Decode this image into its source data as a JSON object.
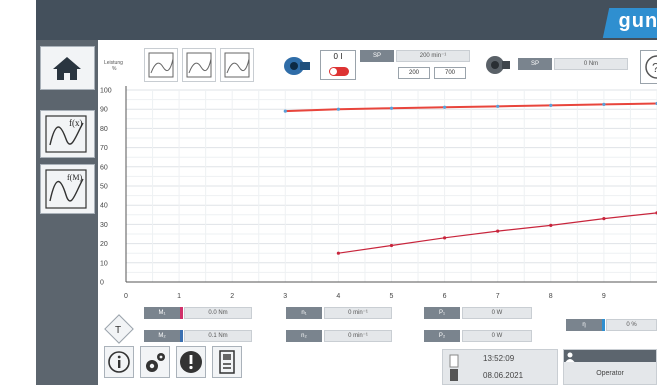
{
  "logo": {
    "text": "gun"
  },
  "header": {
    "axis_unit_line1": "Leistung",
    "axis_unit_line2": "%",
    "speed_sp_label": "SP",
    "speed_sp_value": "200 min⁻¹",
    "speed_min": "200",
    "speed_max": "700",
    "toggle_label": "0 I",
    "torque_sp_label": "SP",
    "torque_sp_value": "0 Nm"
  },
  "chart_data": {
    "type": "line",
    "x_ticks": [
      "0",
      "1",
      "2",
      "3",
      "4",
      "5",
      "6",
      "7",
      "8",
      "9"
    ],
    "y_ticks": [
      "100",
      "90",
      "80",
      "70",
      "60",
      "50",
      "40",
      "30",
      "20",
      "10",
      "0"
    ],
    "xlim": [
      0,
      10
    ],
    "ylim": [
      0,
      100
    ],
    "grid": true,
    "series": [
      {
        "color": "#e8453c",
        "x": [
          3,
          4,
          5,
          6,
          7,
          8,
          9,
          10
        ],
        "y": [
          89,
          90,
          90.5,
          91,
          91.5,
          92,
          92.5,
          93
        ]
      },
      {
        "color": "#c8253c",
        "x": [
          4,
          5,
          6,
          7,
          8,
          9,
          10
        ],
        "y": [
          15,
          19,
          23,
          26.5,
          29.5,
          33,
          36
        ]
      }
    ]
  },
  "readouts": {
    "m1_label": "M₁",
    "m1_value": "0.0 Nm",
    "m2_label": "M₂",
    "m2_value": "0.1 Nm",
    "n1_label": "n₁",
    "n1_value": "0 min⁻¹",
    "n2_label": "n₂",
    "n2_value": "0 min⁻¹",
    "p1_label": "P₁",
    "p1_value": "0 W",
    "p2_label": "P₂",
    "p2_value": "0 W",
    "eta_label": "η",
    "eta_value": "0 %"
  },
  "footer": {
    "time": "13:52:09",
    "date": "08.06.2021",
    "user": "Operator"
  },
  "colors": {
    "accent": "#2f8fd0",
    "topbar": "#44505c",
    "sidebar": "#5c656e",
    "curve_upper": "#e8453c",
    "curve_lower": "#c8253c"
  },
  "icons": [
    "home-icon",
    "function-chart-icon",
    "characteristic-chart-icon",
    "motor-icon",
    "brake-icon",
    "info-icon",
    "settings-icon",
    "alert-icon",
    "device-icon",
    "temperature-icon",
    "help-icon",
    "user-icon",
    "clock-icon"
  ]
}
